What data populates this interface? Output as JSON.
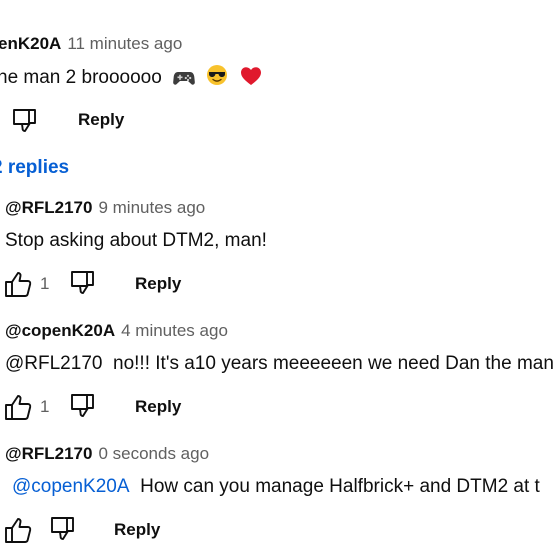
{
  "parent_comment": {
    "author": "enK20A",
    "time": "11 minutes ago",
    "text": "he man 2 broooooo",
    "emojis": [
      "gamepad-icon",
      "cool-face-icon",
      "heart-icon"
    ],
    "reply_label": "Reply"
  },
  "replies_toggle": "2 replies",
  "replies": [
    {
      "author": "@RFL2170",
      "time": "9 minutes ago",
      "mention": "",
      "text": "Stop asking about DTM2, man!",
      "likes": "1",
      "reply_label": "Reply"
    },
    {
      "author": "@copenK20A",
      "time": "4 minutes ago",
      "mention": "@RFL2170",
      "text": "no!!! It's a10 years meeeeeen we need Dan the man",
      "likes": "1",
      "reply_label": "Reply"
    },
    {
      "author": "@RFL2170",
      "time": "0 seconds ago",
      "mention": "@copenK20A",
      "text": "How can you manage Halfbrick+ and DTM2 at t",
      "likes": "",
      "reply_label": "Reply"
    }
  ],
  "colors": {
    "link": "#065fd4",
    "secondary": "#606060",
    "text": "#0f0f0f"
  }
}
